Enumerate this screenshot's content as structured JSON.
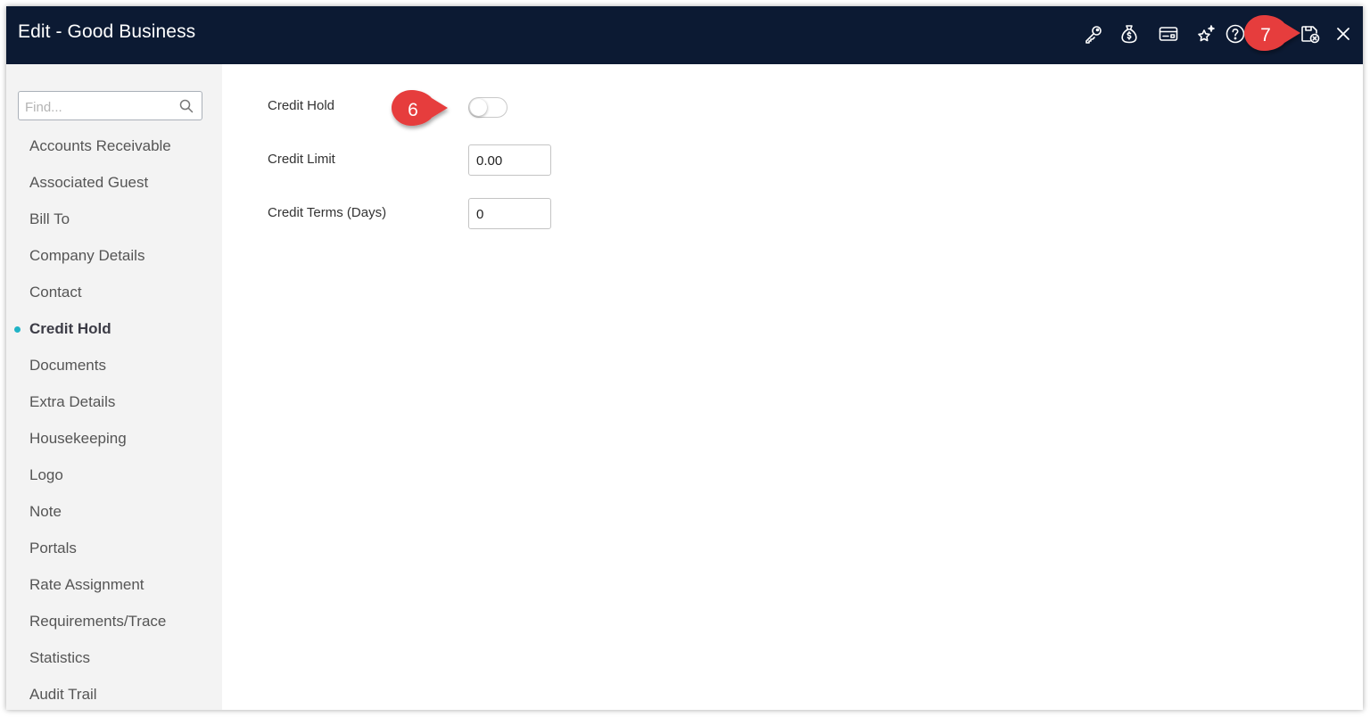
{
  "window": {
    "title": "Edit - Good Business"
  },
  "header_icons": [
    "key-icon",
    "money-bag-icon",
    "card-icon",
    "sparkle-star-icon",
    "help-icon",
    "save-close-icon",
    "close-icon"
  ],
  "colors": {
    "header_bg": "#0c1a33",
    "sidebar_bg": "#f3f3f3",
    "active_dot": "#20b3c6",
    "callout_red": "#e63c3c"
  },
  "sidebar": {
    "search_placeholder": "Find...",
    "items": [
      {
        "label": "Accounts Receivable"
      },
      {
        "label": "Associated Guest"
      },
      {
        "label": "Bill To"
      },
      {
        "label": "Company Details"
      },
      {
        "label": "Contact"
      },
      {
        "label": "Credit Hold",
        "active": true
      },
      {
        "label": "Documents"
      },
      {
        "label": "Extra Details"
      },
      {
        "label": "Housekeeping"
      },
      {
        "label": "Logo"
      },
      {
        "label": "Note"
      },
      {
        "label": "Portals"
      },
      {
        "label": "Rate Assignment"
      },
      {
        "label": "Requirements/Trace"
      },
      {
        "label": "Statistics"
      },
      {
        "label": "Audit Trail"
      }
    ]
  },
  "form": {
    "credit_hold": {
      "label": "Credit Hold",
      "on": false
    },
    "credit_limit": {
      "label": "Credit Limit",
      "value": "0.00"
    },
    "credit_terms": {
      "label": "Credit Terms (Days)",
      "value": "0"
    }
  },
  "callouts": {
    "six": "6",
    "seven": "7"
  }
}
